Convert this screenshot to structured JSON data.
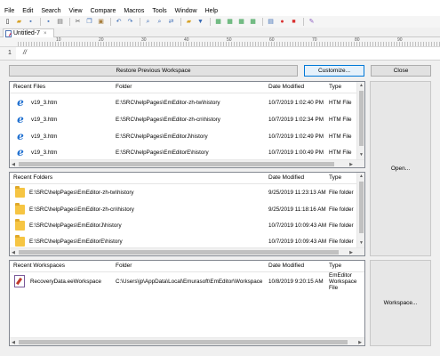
{
  "menu": [
    "File",
    "Edit",
    "Search",
    "View",
    "Compare",
    "Macros",
    "Tools",
    "Window",
    "Help"
  ],
  "toolbar_icons": [
    "new-document-icon",
    "open-folder-icon",
    "save-icon",
    "save-all-icon",
    "print-icon",
    "cut-icon",
    "copy-icon",
    "paste-icon",
    "undo-icon",
    "redo-icon",
    "find-icon",
    "find-next-icon",
    "replace-icon",
    "find-in-files-icon",
    "filter-icon",
    "window-icon",
    "split-icon",
    "compare-icon",
    "outline-icon",
    "macro-icon",
    "record-icon",
    "stop-icon",
    "customize-icon"
  ],
  "tab": {
    "label": "Untitled-7",
    "close": "×"
  },
  "ruler": {
    "marks": [
      "10",
      "20",
      "30",
      "40",
      "50",
      "60",
      "70",
      "80",
      "90"
    ]
  },
  "editor": {
    "line_number": "1",
    "content": "//"
  },
  "buttons": {
    "restore": "Restore Previous Workspace",
    "customize": "Customize...",
    "close": "Close",
    "open": "Open...",
    "workspace": "Workspace..."
  },
  "recent_files": {
    "headers": [
      "Recent Files",
      "Folder",
      "Date Modified",
      "Type"
    ],
    "rows": [
      {
        "name": "v19_3.htm",
        "folder": "E:\\SRC\\helpPages\\EmEditor-zh-tw\\history",
        "date": "10/7/2019 1:02:40 PM",
        "type": "HTM File"
      },
      {
        "name": "v19_3.htm",
        "folder": "E:\\SRC\\helpPages\\EmEditor-zh-cn\\history",
        "date": "10/7/2019 1:02:34 PM",
        "type": "HTM File"
      },
      {
        "name": "v19_3.htm",
        "folder": "E:\\SRC\\helpPages\\EmEditorJ\\history",
        "date": "10/7/2019 1:02:49 PM",
        "type": "HTM File"
      },
      {
        "name": "v19_3.htm",
        "folder": "E:\\SRC\\helpPages\\EmEditorE\\history",
        "date": "10/7/2019 1:00:49 PM",
        "type": "HTM File"
      }
    ]
  },
  "recent_folders": {
    "headers": [
      "Recent Folders",
      "Date Modified",
      "Type"
    ],
    "rows": [
      {
        "name": "E:\\SRC\\helpPages\\EmEditor-zh-tw\\history",
        "date": "9/25/2019 11:23:13 AM",
        "type": "File folder"
      },
      {
        "name": "E:\\SRC\\helpPages\\EmEditor-zh-cn\\history",
        "date": "9/25/2019 11:18:16 AM",
        "type": "File folder"
      },
      {
        "name": "E:\\SRC\\helpPages\\EmEditorJ\\history",
        "date": "10/7/2019 10:09:43 AM",
        "type": "File folder"
      },
      {
        "name": "E:\\SRC\\helpPages\\EmEditorE\\history",
        "date": "10/7/2019 10:09:43 AM",
        "type": "File folder"
      }
    ]
  },
  "recent_workspaces": {
    "headers": [
      "Recent Workspaces",
      "Folder",
      "Date Modified",
      "Type"
    ],
    "rows": [
      {
        "name": "RecoveryData.eeWorkspace",
        "folder": "C:\\Users\\jp\\AppData\\Local\\Emurasoft\\EmEditor\\Workspace",
        "date": "10/8/2019 9:20:15 AM",
        "type": "EmEditor Workspace File"
      }
    ]
  },
  "colors": {
    "accent": "#0078d7",
    "ie_blue": "#1e6fd0",
    "folder": "#f6c543"
  }
}
